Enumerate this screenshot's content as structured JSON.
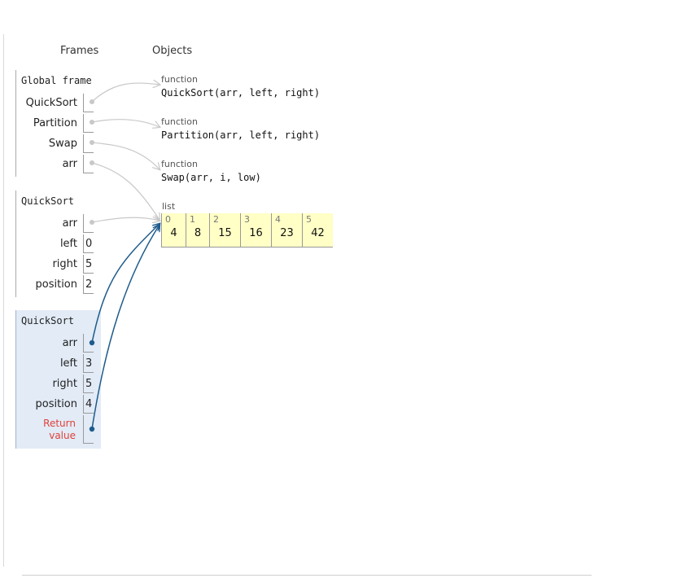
{
  "headers": {
    "frames": "Frames",
    "objects": "Objects"
  },
  "frames": [
    {
      "title": "Global frame",
      "active": false,
      "vars": [
        {
          "name": "QuickSort",
          "value": ""
        },
        {
          "name": "Partition",
          "value": ""
        },
        {
          "name": "Swap",
          "value": ""
        },
        {
          "name": "arr",
          "value": ""
        }
      ]
    },
    {
      "title": "QuickSort",
      "active": false,
      "vars": [
        {
          "name": "arr",
          "value": ""
        },
        {
          "name": "left",
          "value": "0"
        },
        {
          "name": "right",
          "value": "5"
        },
        {
          "name": "position",
          "value": "2"
        }
      ]
    },
    {
      "title": "QuickSort",
      "active": true,
      "vars": [
        {
          "name": "arr",
          "value": ""
        },
        {
          "name": "left",
          "value": "3"
        },
        {
          "name": "right",
          "value": "5"
        },
        {
          "name": "position",
          "value": "4"
        },
        {
          "name": "Return value",
          "value": ""
        }
      ]
    }
  ],
  "objects": {
    "functions": [
      {
        "label": "function",
        "signature": "QuickSort(arr, left, right)"
      },
      {
        "label": "function",
        "signature": "Partition(arr, left, right)"
      },
      {
        "label": "function",
        "signature": "Swap(arr, i, low)"
      }
    ],
    "list": {
      "label": "list",
      "indices": [
        "0",
        "1",
        "2",
        "3",
        "4",
        "5"
      ],
      "values": [
        "4",
        "8",
        "15",
        "16",
        "23",
        "42"
      ]
    }
  },
  "colors": {
    "pointer_inactive": "#c8c8c8",
    "pointer_active": "#1e5b8c",
    "list_fill": "#ffffc6",
    "active_frame": "#e2ebf6",
    "return_label": "#e0403a"
  }
}
